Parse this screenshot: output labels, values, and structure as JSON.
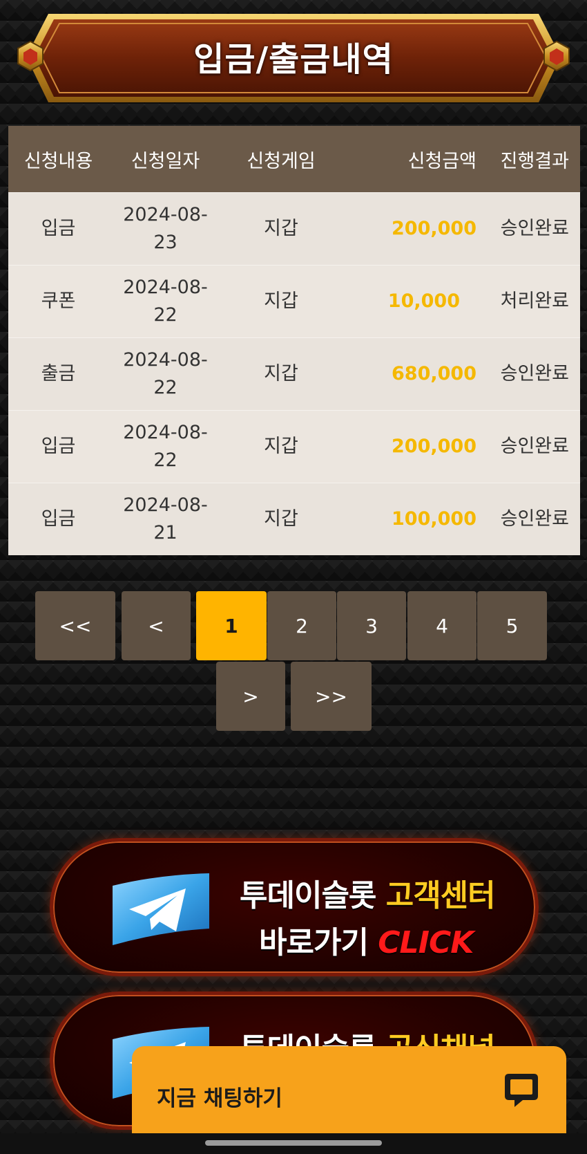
{
  "page": {
    "title": "입금/출금내역"
  },
  "table": {
    "headers": [
      "신청내용",
      "신청일자",
      "신청게임",
      "신청금액",
      "진행결과"
    ],
    "rows": [
      {
        "type": "입금",
        "date_1": "2024-08-",
        "date_2": "23",
        "game": "지갑",
        "amount": "200,000",
        "status": "승인완료"
      },
      {
        "type": "쿠폰",
        "date_1": "2024-08-",
        "date_2": "22",
        "game": "지갑",
        "amount": "10,000",
        "status": "처리완료"
      },
      {
        "type": "출금",
        "date_1": "2024-08-",
        "date_2": "22",
        "game": "지갑",
        "amount": "680,000",
        "status": "승인완료"
      },
      {
        "type": "입금",
        "date_1": "2024-08-",
        "date_2": "22",
        "game": "지갑",
        "amount": "200,000",
        "status": "승인완료"
      },
      {
        "type": "입금",
        "date_1": "2024-08-",
        "date_2": "21",
        "game": "지갑",
        "amount": "100,000",
        "status": "승인완료"
      }
    ]
  },
  "pagination": {
    "first": "<<",
    "prev": "<",
    "pages": [
      "1",
      "2",
      "3",
      "4",
      "5"
    ],
    "current": "1",
    "next": ">",
    "last": ">>"
  },
  "promos": [
    {
      "line1_a": "투데이슬롯 ",
      "line1_b": "고객센터",
      "line2_a": "바로가기 ",
      "line2_b": "CLICK",
      "icon": "telegram-icon"
    },
    {
      "line1_a": "투데이슬롯 ",
      "line1_b": "공식채널",
      "line2_a": "",
      "line2_b": "",
      "icon": "telegram-icon"
    }
  ],
  "chat": {
    "label": "지금 채팅하기",
    "icon": "chat-bubble-icon"
  },
  "colors": {
    "accent": "#ffb400",
    "amount": "#f5b800",
    "table_header": "#6b5a49",
    "page_button": "#5e5042",
    "chat_widget": "#f7a21b",
    "click_red": "#ff1a1a",
    "highlight_yellow": "#ffcc22"
  }
}
